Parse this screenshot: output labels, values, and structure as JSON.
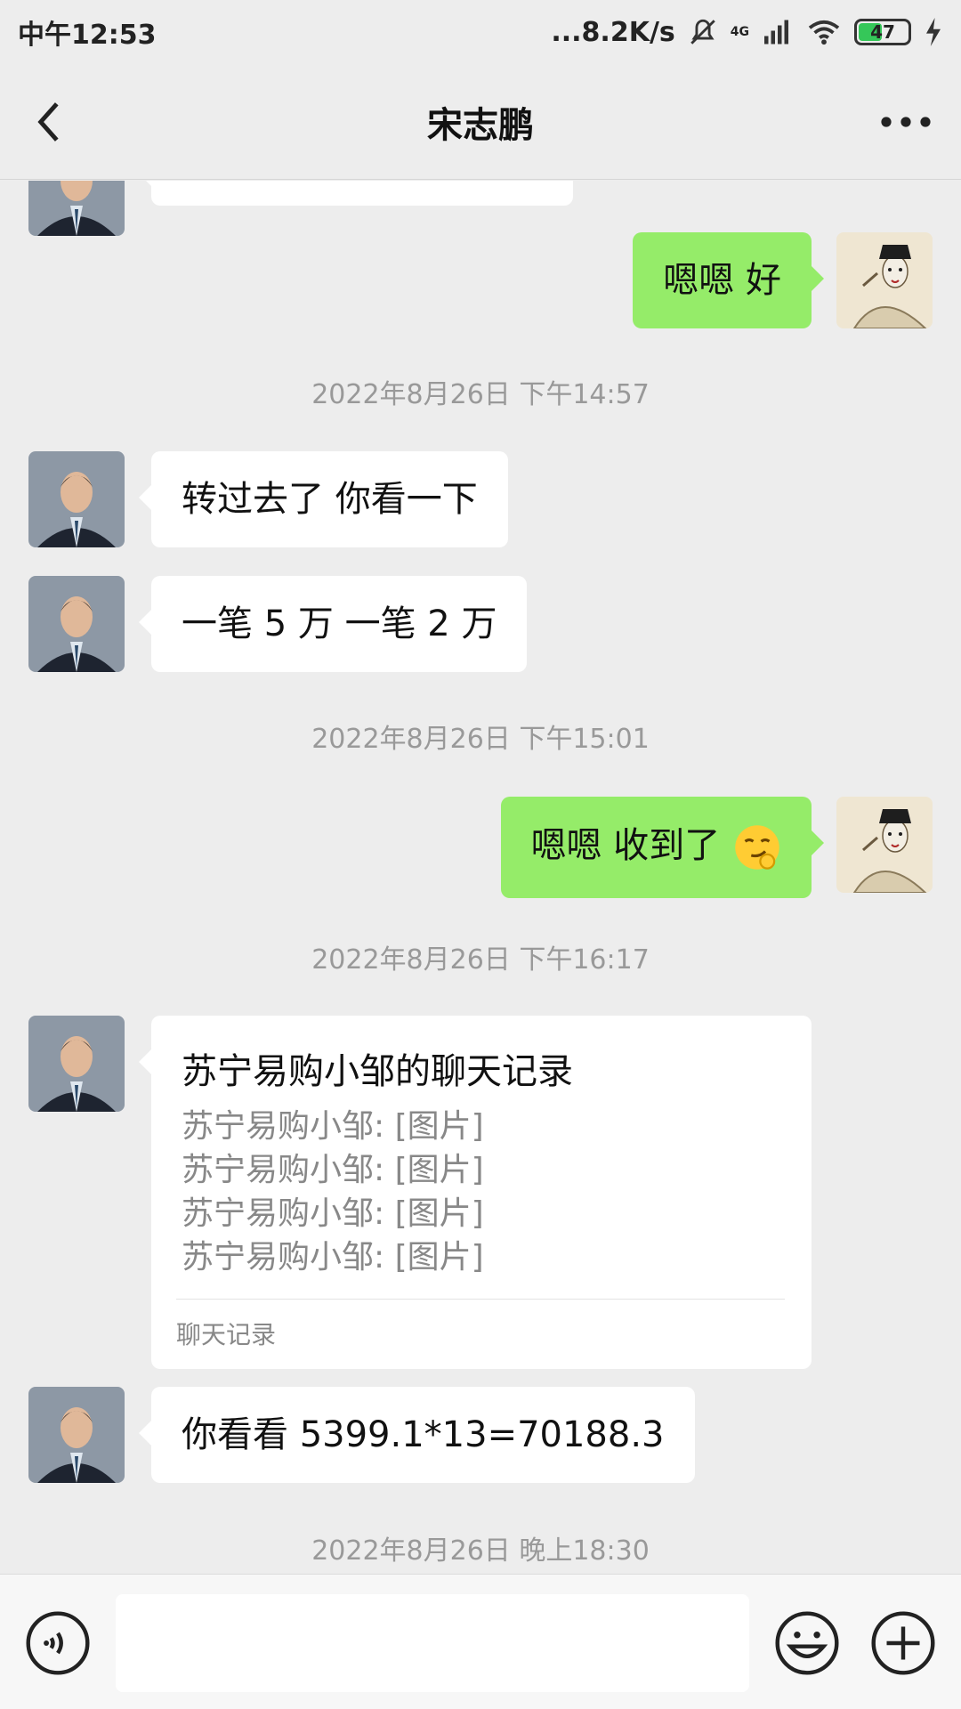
{
  "status_bar": {
    "time": "中午12:53",
    "network_speed": "...8.2K/s",
    "network_type": "4G",
    "battery": "47",
    "battery_level": 0.47
  },
  "header": {
    "title": "宋志鹏"
  },
  "messages": [
    {
      "id": "m1",
      "text": "嗯嗯  好"
    },
    {
      "id": "ts1",
      "text": "2022年8月26日 下午14:57"
    },
    {
      "id": "m2",
      "text": "转过去了  你看一下"
    },
    {
      "id": "m3",
      "text": "一笔 5 万  一笔 2 万"
    },
    {
      "id": "ts2",
      "text": "2022年8月26日 下午15:01"
    },
    {
      "id": "m4",
      "text": "嗯嗯  收到了"
    },
    {
      "id": "ts3",
      "text": "2022年8月26日 下午16:17"
    },
    {
      "id": "m6",
      "text": "你看看 5399.1*13=70188.3"
    },
    {
      "id": "ts4",
      "text": "2022年8月26日 晚上18:30"
    }
  ],
  "chat_record": {
    "title": "苏宁易购小邹的聊天记录",
    "lines": [
      "苏宁易购小邹: [图片]",
      "苏宁易购小邹: [图片]",
      "苏宁易购小邹: [图片]",
      "苏宁易购小邹: [图片]"
    ],
    "footer": "聊天记录"
  },
  "icons": {
    "back": "back-icon",
    "more": "more-icon",
    "voice": "voice-icon",
    "emoji": "emoji-icon",
    "plus": "plus-icon",
    "mute": "mute-icon",
    "signal": "signal-icon",
    "wifi": "wifi-icon",
    "charging": "charging-icon"
  },
  "colors": {
    "sent_bubble": "#95ec69",
    "received_bubble": "#ffffff",
    "background": "#ededed"
  }
}
